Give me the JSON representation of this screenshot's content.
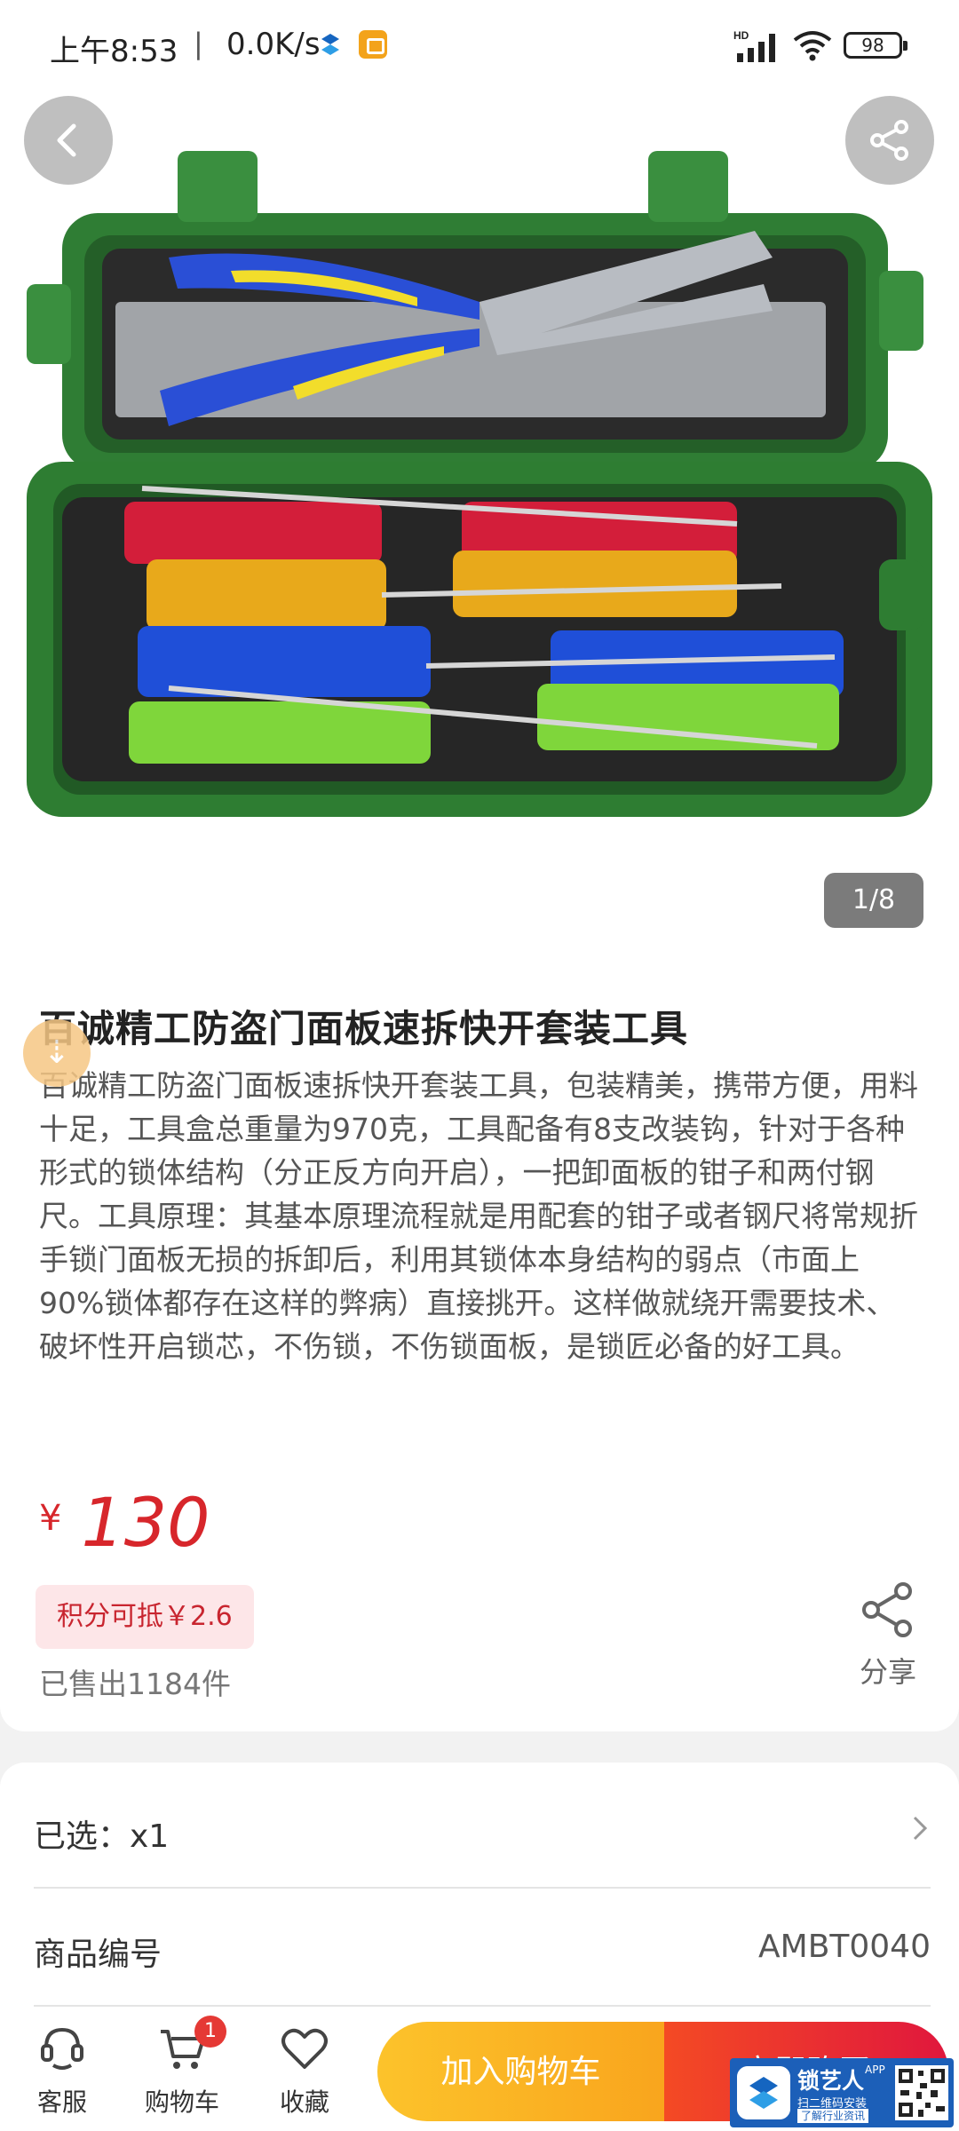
{
  "status_bar": {
    "time": "上午8:53",
    "separator": "|",
    "net_speed": "0.0K/s",
    "battery": "98",
    "icons": [
      "s-app-icon",
      "yellow-app-icon",
      "hd-signal-icon",
      "wifi-icon",
      "battery-icon"
    ]
  },
  "gallery": {
    "pager": "1/8",
    "image_subject": "green tool case with pliers and eight colored pick tools"
  },
  "product": {
    "title": "百诚精工防盗门面板速拆快开套装工具",
    "description": "百诚精工防盗门面板速拆快开套装工具，包装精美，携带方便，用料十足，工具盒总重量为970克，工具配备有8支改装钩，针对于各种形式的锁体结构（分正反方向开启），一把卸面板的钳子和两付钢尺。工具原理：其基本原理流程就是用配套的钳子或者钢尺将常规折手锁门面板无损的拆卸后，利用其锁体本身结构的弱点（市面上90%锁体都存在这样的弊病）直接挑开。这样做就绕开需要技术、破坏性开启锁芯，不伤锁，不伤锁面板，是锁匠必备的好工具。",
    "currency": "¥",
    "price": "130",
    "points_tag": "积分可抵￥2.6",
    "sold": "已售出1184件",
    "share_label": "分享"
  },
  "specs": {
    "selected_label": "已选：x1",
    "code_label": "商品编号",
    "code_value": "AMBT0040"
  },
  "bottom_bar": {
    "service": "客服",
    "cart": "购物车",
    "cart_count": "1",
    "favorite": "收藏",
    "add_to_cart": "加入购物车",
    "buy_now": "立即购买"
  },
  "watermark": {
    "name": "锁艺人",
    "app": "APP",
    "line1": "扫二维码安装",
    "line2": "了解行业资讯"
  },
  "colors": {
    "price_red": "#d7262b",
    "add_cart_orange": "#fcc32b",
    "buy_red": "#e0173d",
    "case_green": "#2e7d32"
  }
}
